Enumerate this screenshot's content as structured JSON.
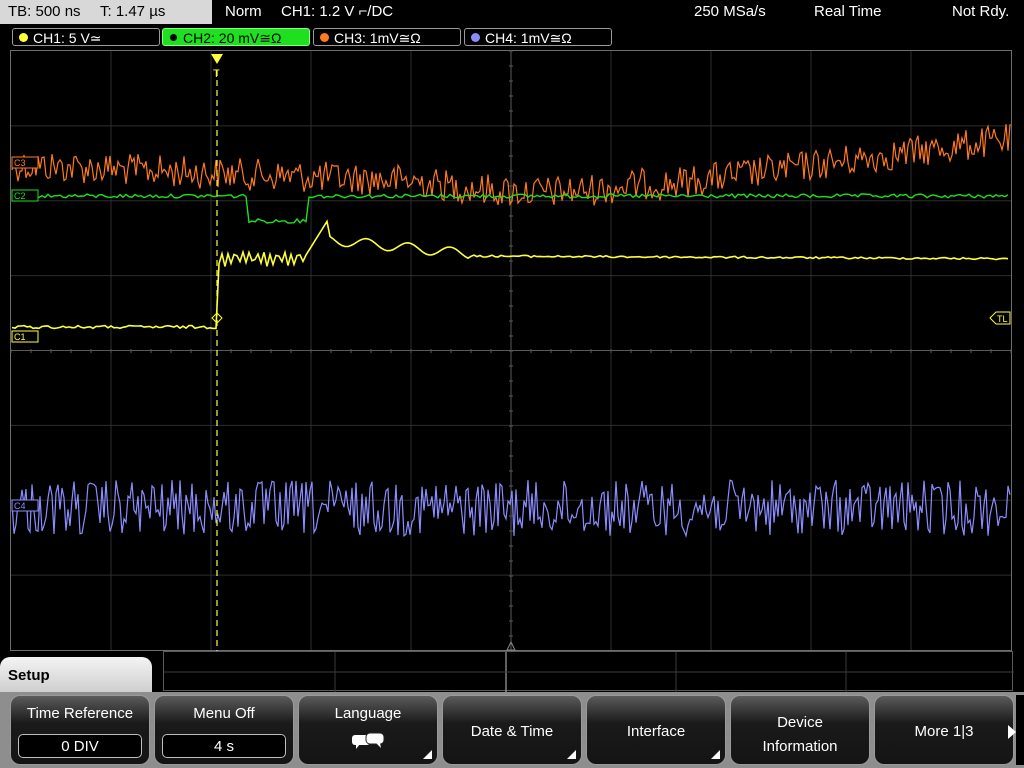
{
  "status": {
    "timebase": "TB: 500 ns",
    "trigger_time": "T: 1.47 µs",
    "trigger_mode": "Norm",
    "trigger_source": "CH1: 1.2 V ⌐/DC",
    "sample_rate": "250 MSa/s",
    "acq_mode": "Real Time",
    "state": "Not Rdy."
  },
  "channels": [
    {
      "label": "CH1: 5 V≃",
      "color": "#ffff3a"
    },
    {
      "label": "CH2: 20 mV≅Ω",
      "color": "#1ee01e"
    },
    {
      "label": "CH3: 1mV≅Ω",
      "color": "#ff7a1e"
    },
    {
      "label": "CH4: 1mV≅Ω",
      "color": "#8c8cff"
    }
  ],
  "markers": {
    "c1": "C1",
    "c2": "C2",
    "c3": "C3",
    "c4": "C4",
    "trigger_level": "TL",
    "trigger_pos": "T"
  },
  "menu": {
    "title": "Setup",
    "softkeys": [
      {
        "label": "Time Reference",
        "value": "0 DIV"
      },
      {
        "label": "Menu Off",
        "value": "4 s"
      },
      {
        "label": "Language",
        "icon": "speech-bubbles-icon"
      },
      {
        "label": "Date & Time"
      },
      {
        "label": "Interface"
      },
      {
        "label": "Device Information"
      },
      {
        "label": "More 1|3"
      }
    ]
  }
}
